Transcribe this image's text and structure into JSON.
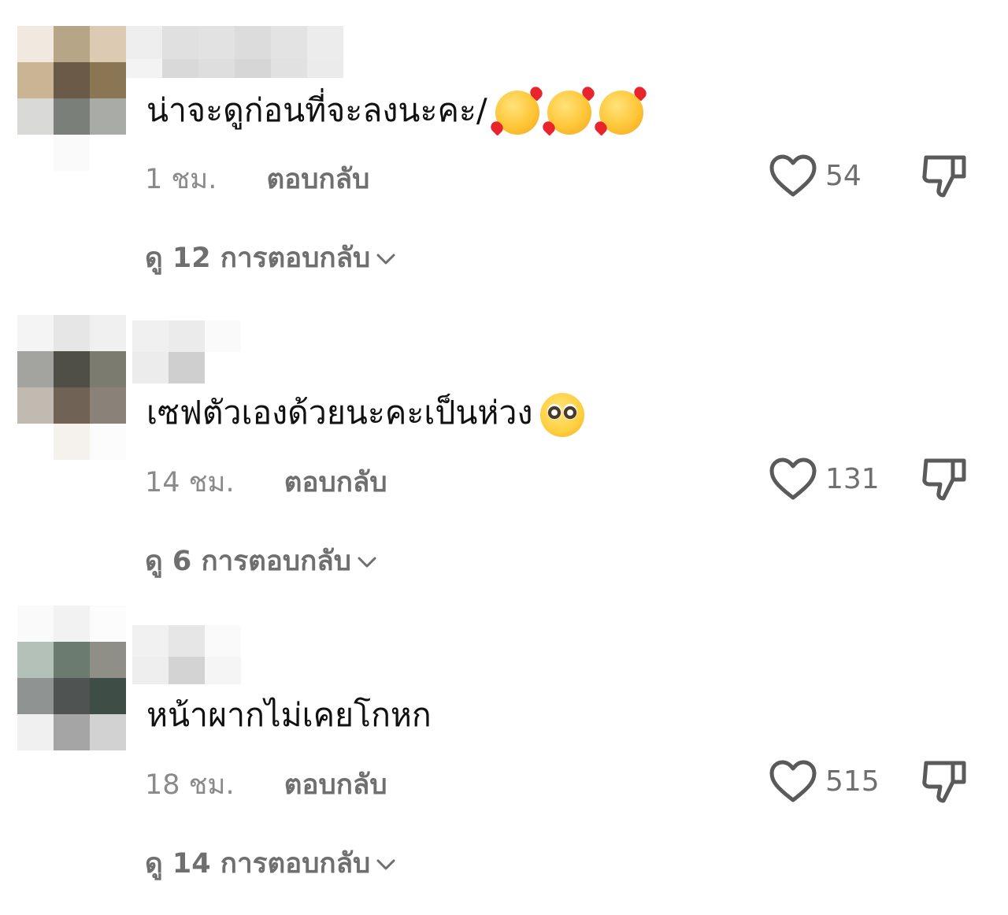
{
  "comments": [
    {
      "text": "น่าจะดูก่อนที่จะลงนะคะ/",
      "emoji": [
        "smiling-face-with-hearts-icon",
        "smiling-face-with-hearts-icon",
        "smiling-face-with-hearts-icon"
      ],
      "time": "1 ชม.",
      "reply_label": "ตอบกลับ",
      "likes": "54",
      "view_replies": "ดู 12 การตอบกลับ"
    },
    {
      "text": "เซฟตัวเองด้วยนะคะเป็นห่วง",
      "emoji": [
        "pleading-face-icon"
      ],
      "time": "14 ชม.",
      "reply_label": "ตอบกลับ",
      "likes": "131",
      "view_replies": "ดู 6 การตอบกลับ"
    },
    {
      "text": "หน้าผากไม่เคยโกหก",
      "emoji": [],
      "time": "18 ชม.",
      "reply_label": "ตอบกลับ",
      "likes": "515",
      "view_replies": "ดู 14 การตอบกลับ"
    }
  ],
  "icons": {
    "like": "heart-icon",
    "dislike": "thumbs-down-icon",
    "expand": "chevron-down-icon"
  },
  "colors": {
    "text": "#111111",
    "secondary": "#8a8a8a",
    "icon": "#5a5a5a"
  }
}
